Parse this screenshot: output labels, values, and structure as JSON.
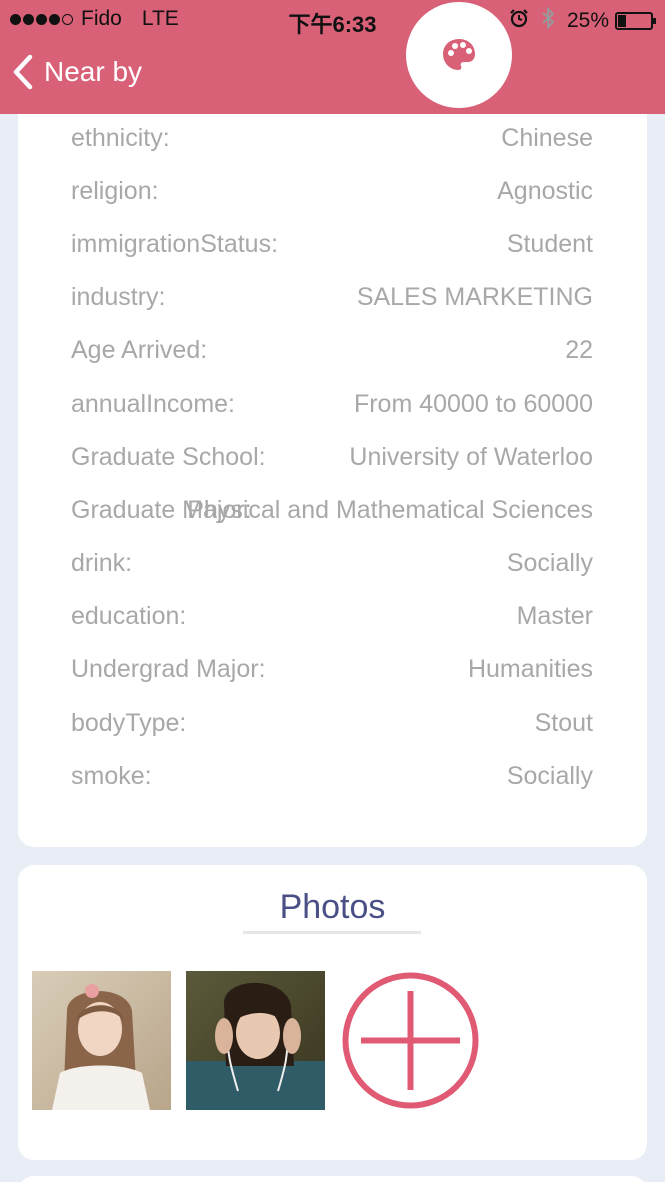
{
  "status_bar": {
    "carrier": "Fido",
    "network": "LTE",
    "time": "下午6:33",
    "battery_percent": "25%",
    "battery_level": 0.25
  },
  "header": {
    "back_label": "Near by",
    "theme_icon": "palette-icon",
    "background_color": "#d86077"
  },
  "details": [
    {
      "label": "ethnicity:",
      "value": "Chinese"
    },
    {
      "label": "religion:",
      "value": "Agnostic"
    },
    {
      "label": "immigrationStatus:",
      "value": "Student"
    },
    {
      "label": "industry:",
      "value": "SALES MARKETING"
    },
    {
      "label": "Age Arrived:",
      "value": "22"
    },
    {
      "label": "annualIncome:",
      "value": "From 40000 to 60000"
    },
    {
      "label": "Graduate School:",
      "value": "University of Waterloo"
    },
    {
      "label": "Graduate Major:",
      "value": "Physical and Mathematical Sciences"
    },
    {
      "label": "drink:",
      "value": "Socially"
    },
    {
      "label": "education:",
      "value": "Master"
    },
    {
      "label": "Undergrad Major:",
      "value": "Humanities"
    },
    {
      "label": "bodyType:",
      "value": "Stout"
    },
    {
      "label": "smoke:",
      "value": "Socially"
    }
  ],
  "photos": {
    "title": "Photos",
    "add_icon": "add-photo-icon",
    "accent_color": "#e05a74"
  }
}
